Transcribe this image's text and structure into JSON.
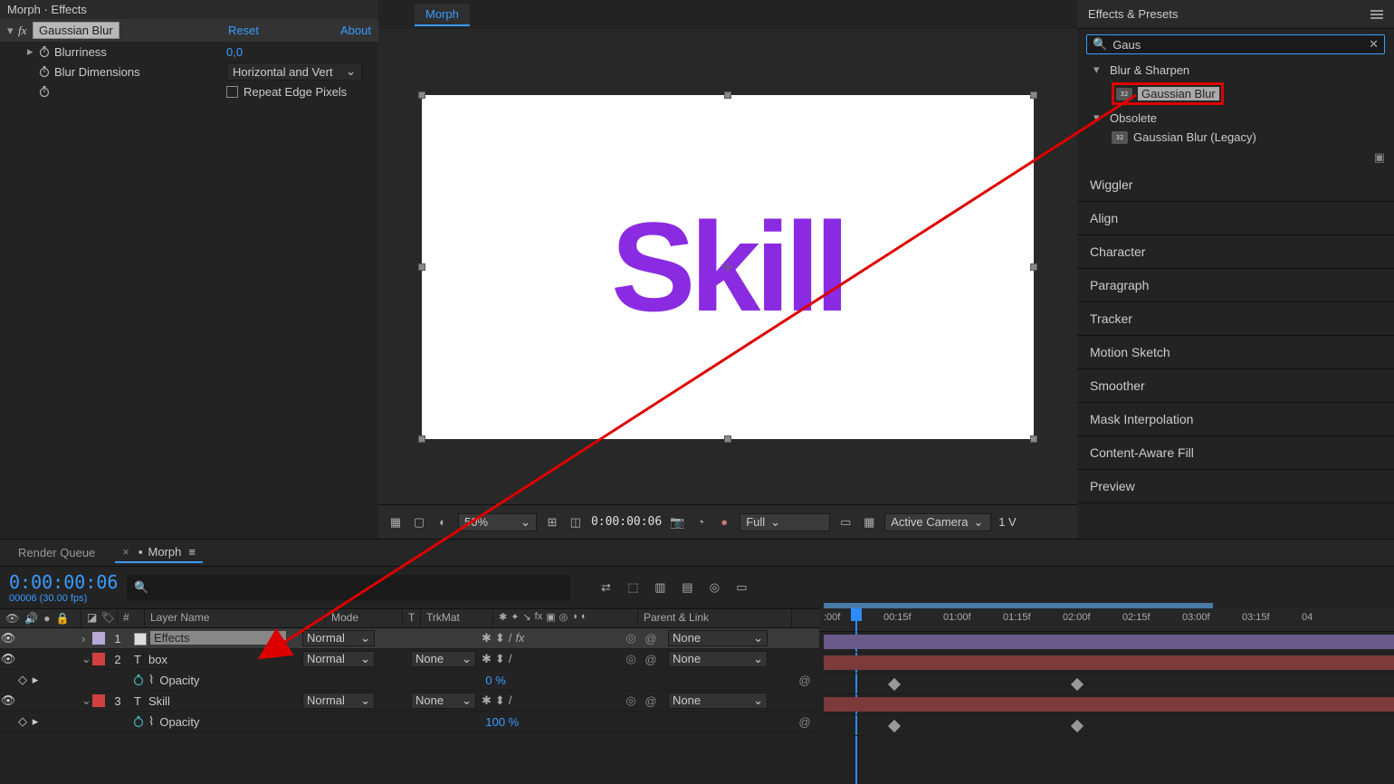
{
  "effect_controls": {
    "breadcrumb": "Morph · Effects",
    "effect_name": "Gaussian Blur",
    "reset": "Reset",
    "about": "About",
    "props": {
      "blurriness_label": "Blurriness",
      "blurriness_value": "0,0",
      "dimensions_label": "Blur Dimensions",
      "dimensions_value": "Horizontal and Vert",
      "repeat_label": "Repeat Edge Pixels"
    }
  },
  "composition": {
    "tab": "Morph",
    "text_layer": "Skill",
    "viewer": {
      "zoom": "50%",
      "time": "0:00:00:06",
      "resolution": "Full",
      "camera": "Active Camera",
      "views": "1 V"
    }
  },
  "effects_presets": {
    "title": "Effects & Presets",
    "search": "Gaus",
    "groups": [
      {
        "name": "Blur & Sharpen",
        "items": [
          "Gaussian Blur"
        ]
      },
      {
        "name": "Obsolete",
        "items": [
          "Gaussian Blur (Legacy)"
        ]
      }
    ],
    "highlighted": "Gaussian Blur"
  },
  "side_panels": [
    "Wiggler",
    "Align",
    "Character",
    "Paragraph",
    "Tracker",
    "Motion Sketch",
    "Smoother",
    "Mask Interpolation",
    "Content-Aware Fill",
    "Preview"
  ],
  "timeline": {
    "tabs": {
      "render_queue": "Render Queue",
      "comp": "Morph"
    },
    "current_time": "0:00:00:06",
    "frame_info": "00006 (30.00 fps)",
    "columns": {
      "num": "#",
      "layer_name": "Layer Name",
      "mode": "Mode",
      "t": "T",
      "trkmat": "TrkMat",
      "parent": "Parent & Link"
    },
    "ruler": [
      ":00f",
      "00:15f",
      "01:00f",
      "01:15f",
      "02:00f",
      "02:15f",
      "03:00f",
      "03:15f",
      "04"
    ],
    "layers": [
      {
        "num": "1",
        "color": "#b6a8d8",
        "name": "Effects",
        "type": "adj",
        "mode": "Normal",
        "trkmat": "",
        "parent": "None",
        "selected": true,
        "bar_color": "#6a5a8a"
      },
      {
        "num": "2",
        "color": "#d14040",
        "name": "box",
        "type": "T",
        "mode": "Normal",
        "trkmat": "None",
        "parent": "None",
        "bar_color": "#7d3a3a",
        "props": [
          {
            "label": "Opacity",
            "value": "0 %"
          }
        ]
      },
      {
        "num": "3",
        "color": "#d14040",
        "name": "Skill",
        "type": "T",
        "mode": "Normal",
        "trkmat": "None",
        "parent": "None",
        "bar_color": "#7d3a3a",
        "props": [
          {
            "label": "Opacity",
            "value": "100 %"
          }
        ]
      }
    ]
  }
}
